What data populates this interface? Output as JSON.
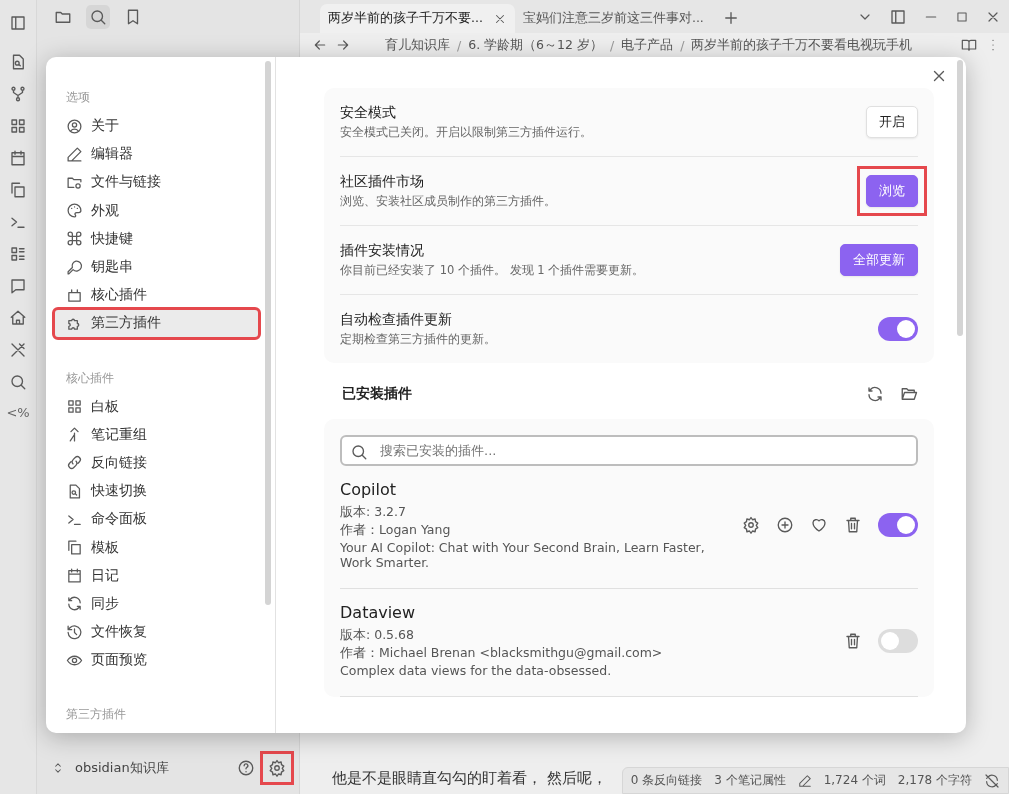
{
  "tabs": [
    {
      "title": "两岁半前的孩子千万不要...",
      "selected": true
    },
    {
      "title": "宝妈们注意三岁前这三件事对...",
      "selected": false
    }
  ],
  "ribbon_label": "<%",
  "breadcrumb": [
    "育儿知识库",
    "6. 学龄期（6～12 岁）",
    "电子产品",
    "两岁半前的孩子千万不要看电视玩手机"
  ],
  "breadcrumb_separators": [
    "/",
    "/",
    "/"
  ],
  "editor_lines": [
    "他是不是眼睛直勾勾的盯着看， 然后呢，"
  ],
  "vault": {
    "name": "obsidian知识库",
    "settings_highlighted": true
  },
  "status_bar": [
    "0 条反向链接",
    "3 个笔记属性",
    "1,724 个词",
    "2,178 个字符"
  ],
  "settings": {
    "nav": [
      {
        "heading": "选项",
        "items": [
          {
            "label": "关于",
            "selected": false,
            "highlighted": false
          },
          {
            "label": "编辑器",
            "selected": false,
            "highlighted": false
          },
          {
            "label": "文件与链接",
            "selected": false,
            "highlighted": false
          },
          {
            "label": "外观",
            "selected": false,
            "highlighted": false
          },
          {
            "label": "快捷键",
            "selected": false,
            "highlighted": false
          },
          {
            "label": "钥匙串",
            "selected": false,
            "highlighted": false
          },
          {
            "label": "核心插件",
            "selected": false,
            "highlighted": false
          },
          {
            "label": "第三方插件",
            "selected": true,
            "highlighted": true
          }
        ]
      },
      {
        "heading": "核心插件",
        "items": [
          {
            "label": "白板",
            "selected": false,
            "highlighted": false
          },
          {
            "label": "笔记重组",
            "selected": false,
            "highlighted": false
          },
          {
            "label": "反向链接",
            "selected": false,
            "highlighted": false
          },
          {
            "label": "快速切换",
            "selected": false,
            "highlighted": false
          },
          {
            "label": "命令面板",
            "selected": false,
            "highlighted": false
          },
          {
            "label": "模板",
            "selected": false,
            "highlighted": false
          },
          {
            "label": "日记",
            "selected": false,
            "highlighted": false
          },
          {
            "label": "同步",
            "selected": false,
            "highlighted": false
          },
          {
            "label": "文件恢复",
            "selected": false,
            "highlighted": false
          },
          {
            "label": "页面预览",
            "selected": false,
            "highlighted": false
          }
        ]
      },
      {
        "heading": "第三方插件"
      }
    ],
    "rows": [
      {
        "kind": "button",
        "title": "安全模式",
        "description": "安全模式已关闭。开启以限制第三方插件运行。",
        "button": "开启",
        "highlighted": false
      },
      {
        "kind": "primary-button",
        "title": "社区插件市场",
        "description": "浏览、安装社区成员制作的第三方插件。",
        "button": "浏览",
        "highlighted": true
      },
      {
        "kind": "primary-button",
        "title": "插件安装情况",
        "description": "你目前已经安装了 10 个插件。 发现 1 个插件需要更新。",
        "button": "全部更新",
        "highlighted": false
      },
      {
        "kind": "toggle",
        "title": "自动检查插件更新",
        "description": "定期检查第三方插件的更新。",
        "on": true
      }
    ],
    "installed_heading": "已安装插件",
    "search": {
      "placeholder": "搜索已安装的插件..."
    },
    "plugins": [
      {
        "kind": "full",
        "name": "Copilot",
        "version": "版本: 3.2.7",
        "author": "作者：Logan Yang",
        "description": "Your AI Copilot: Chat with Your Second Brain, Learn Faster, Work Smarter.",
        "on": true
      },
      {
        "kind": "basic",
        "name": "Dataview",
        "version": "版本: 0.5.68",
        "author": "作者：Michael Brenan <blacksmithgu@gmail.com>",
        "description": "Complex data views for the data-obsessed.",
        "on": false
      }
    ]
  }
}
